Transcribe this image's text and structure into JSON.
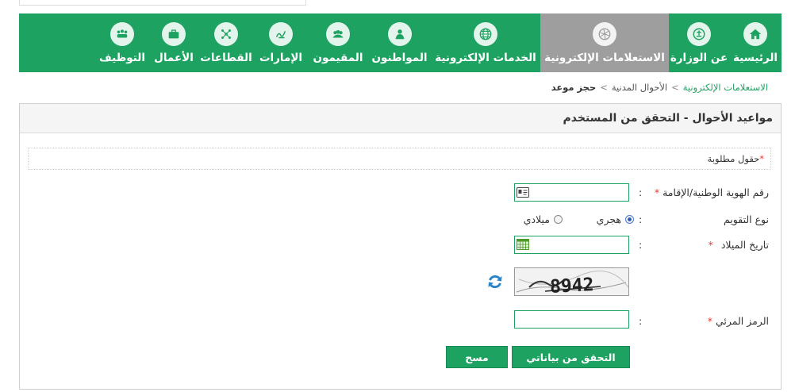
{
  "nav": {
    "items": [
      {
        "label": "الرئيسية",
        "icon": "home-icon"
      },
      {
        "label": "عن الوزارة",
        "icon": "ministry-emblem-icon"
      },
      {
        "label": "الاستعلامات الإلكترونية",
        "icon": "e-inquiries-globe-icon",
        "active": true
      },
      {
        "label": "الخدمات الإلكترونية",
        "icon": "globe-icon"
      },
      {
        "label": "المواطنون",
        "icon": "citizen-icon"
      },
      {
        "label": "المقيمون",
        "icon": "residents-group-icon"
      },
      {
        "label": "الإمارات",
        "icon": "emirates-calligraphy-icon"
      },
      {
        "label": "القطاعات",
        "icon": "sectors-network-icon"
      },
      {
        "label": "الأعمال",
        "icon": "briefcase-icon"
      },
      {
        "label": "التوظيف",
        "icon": "employment-people-icon"
      }
    ],
    "background": "#1da261",
    "active_background": "#9e9e9e"
  },
  "breadcrumb": {
    "level1": "الاستعلامات الإلكترونية",
    "level2": "الأحوال المدنية",
    "current": "حجز موعد",
    "separator": ">"
  },
  "panel": {
    "title": "مواعيد الأحوال - التحقق من المستخدم"
  },
  "form": {
    "required_note": "حقول مطلوبة",
    "required_mark": "*",
    "colon": ":",
    "id_label": "رقم الهوية الوطنية/الإقامة",
    "id_value": "",
    "calendar_label": "نوع التقويم",
    "calendar_options": [
      "هجري",
      "ميلادي"
    ],
    "calendar_selected": "هجري",
    "birthdate_label": "تاريخ الميلاد",
    "birthdate_value": "",
    "captcha_text": "8942",
    "visual_code_label": "الرمز المرئي",
    "visual_code_value": "",
    "verify_button": "التحقق من بياناتي",
    "clear_button": "مسح"
  },
  "colors": {
    "accent": "#1da261",
    "required": "#e53935"
  }
}
